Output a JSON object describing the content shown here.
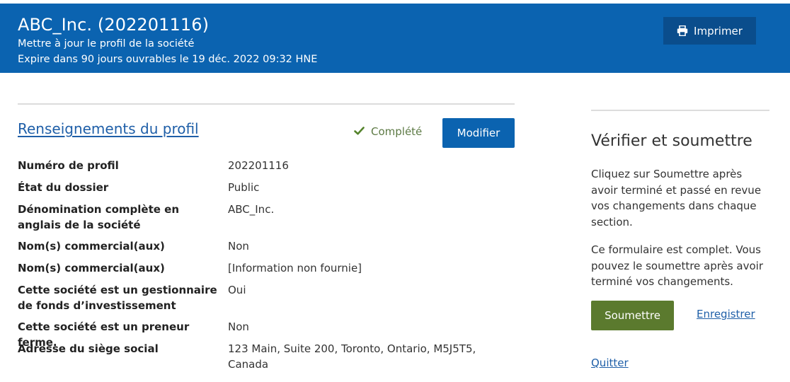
{
  "header": {
    "title": "ABC_Inc. (202201116)",
    "subtitle": "Mettre à jour le profil de la société",
    "expiry": "Expire dans 90 jours ouvrables le 19 déc. 2022 09:32 HNE",
    "print_label": "Imprimer",
    "print_icon": "printer-icon"
  },
  "profile_section": {
    "title": "Renseignements du profil",
    "status_label": "Complété",
    "status_icon": "checkmark-icon",
    "status_color": "#54832b",
    "modify_label": "Modifier",
    "rows": [
      {
        "label": "Numéro de profil",
        "value": "202201116"
      },
      {
        "label": "État du dossier",
        "value": "Public"
      },
      {
        "label": "Dénomination complète en anglais de la société",
        "value": "ABC_Inc."
      },
      {
        "label": "Nom(s) commercial(aux)",
        "value": "Non"
      },
      {
        "label": "Nom(s) commercial(aux)",
        "value": "[Information non fournie]"
      },
      {
        "label": "Cette société est un gestionnaire de fonds d’investissement",
        "value": "Oui"
      },
      {
        "label": "Cette société est un preneur ferme.",
        "value": "Non"
      },
      {
        "label": "Adresse du siège social",
        "value": "123 Main, Suite 200, Toronto, Ontario, M5J5T5, Canada"
      }
    ]
  },
  "sidebar": {
    "title": "Vérifier et soumettre",
    "paragraph1": "Cliquez sur Soumettre après avoir terminé et passé en revue vos changements dans chaque section.",
    "paragraph2": "Ce formulaire est complet. Vous pouvez le soumettre après avoir terminé vos changements.",
    "submit_label": "Soumettre",
    "save_label": "Enregistrer",
    "quit_label": "Quitter"
  },
  "colors": {
    "header_bg": "#0b63b0",
    "print_button_bg": "#0a4d8c",
    "primary_button": "#0b63b0",
    "submit_button": "#5b7a2e",
    "link": "#1f5fa8"
  }
}
